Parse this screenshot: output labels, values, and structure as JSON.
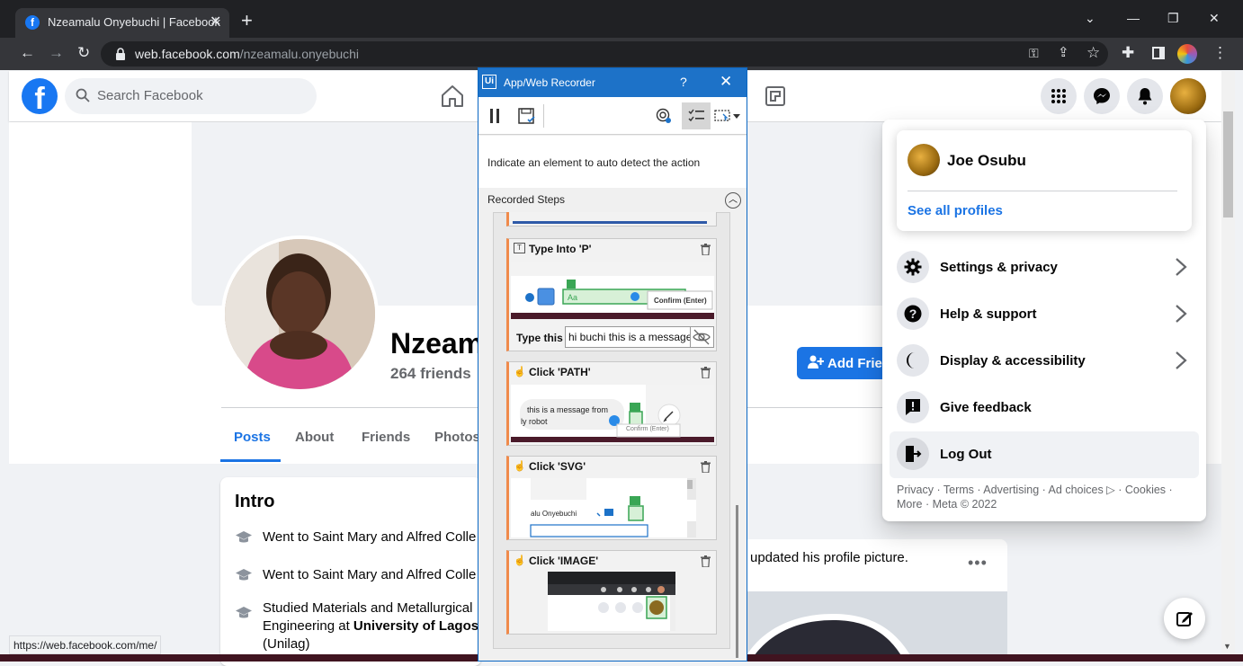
{
  "browser": {
    "tab_title": "Nzeamalu Onyebuchi | Facebook",
    "url_host": "web.facebook.com",
    "url_path": "/nzeamalu.onyebuchi",
    "status_url": "https://web.facebook.com/me/"
  },
  "facebook": {
    "search_placeholder": "Search Facebook",
    "profile_name": "Nzeam",
    "friends_count": "264 friends",
    "add_friend_label": "Add Frien",
    "tabs": [
      "Posts",
      "About",
      "Friends",
      "Photos"
    ],
    "intro": {
      "title": "Intro",
      "items": [
        "Went to Saint Mary and Alfred Colle",
        "Went to Saint Mary and Alfred Colle",
        "Studied Materials and Metallurgical"
      ],
      "study_line2_prefix": "Engineering at ",
      "study_line2_bold": "University of Lagos,",
      "study_line3": "(Unilag)"
    },
    "post_text": "updated his profile picture."
  },
  "account_menu": {
    "user_name": "Joe Osubu",
    "see_all_profiles": "See all profiles",
    "items": [
      {
        "label": "Settings & privacy",
        "icon": "gear-icon"
      },
      {
        "label": "Help & support",
        "icon": "question-icon"
      },
      {
        "label": "Display & accessibility",
        "icon": "moon-icon"
      },
      {
        "label": "Give feedback",
        "icon": "feedback-icon"
      },
      {
        "label": "Log Out",
        "icon": "logout-icon"
      }
    ],
    "footer_line1": "Privacy · Terms · Advertising · Ad choices ▷ · Cookies ·",
    "footer_line2": "More · Meta © 2022"
  },
  "recorder": {
    "title": "App/Web Recorder",
    "help": "?",
    "hint": "Indicate an element to auto detect the action",
    "steps_header": "Recorded Steps",
    "steps": [
      {
        "title": "Type Into 'P'",
        "field_label": "Type this",
        "field_value": "hi buchi this is a message",
        "shot_text": "Confirm (Enter)"
      },
      {
        "title": "Click 'PATH'",
        "shot_text_1": "this is a message from",
        "shot_text_2": "ly robot",
        "shot_text_3": "Confirm (Enter)"
      },
      {
        "title": "Click 'SVG'",
        "shot_text": "alu Onyebuchi"
      },
      {
        "title": "Click 'IMAGE'"
      }
    ]
  }
}
